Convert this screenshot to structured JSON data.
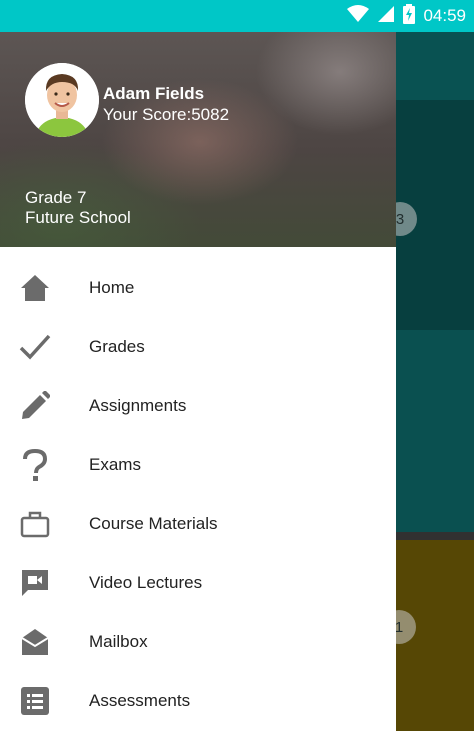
{
  "status_bar": {
    "time": "04:59",
    "icons": [
      "wifi-icon",
      "signal-icon",
      "battery-charging-icon"
    ],
    "background": "#00c7c7"
  },
  "profile": {
    "name": "Adam Fields",
    "score": "Your Score:5082",
    "grade": "Grade 7",
    "school": "Future School"
  },
  "background_content": {
    "badge_top": "3",
    "badge_bottom": "1"
  },
  "menu": {
    "items": [
      {
        "label": "Home",
        "icon": "home-icon"
      },
      {
        "label": "Grades",
        "icon": "check-icon"
      },
      {
        "label": "Assignments",
        "icon": "pencil-icon"
      },
      {
        "label": "Exams",
        "icon": "question-icon"
      },
      {
        "label": "Course Materials",
        "icon": "briefcase-icon"
      },
      {
        "label": "Video Lectures",
        "icon": "video-message-icon"
      },
      {
        "label": "Mailbox",
        "icon": "mail-open-icon"
      },
      {
        "label": "Assessments",
        "icon": "list-icon"
      }
    ]
  },
  "colors": {
    "icon": "#6b6b6b",
    "menu_text": "#222222"
  }
}
